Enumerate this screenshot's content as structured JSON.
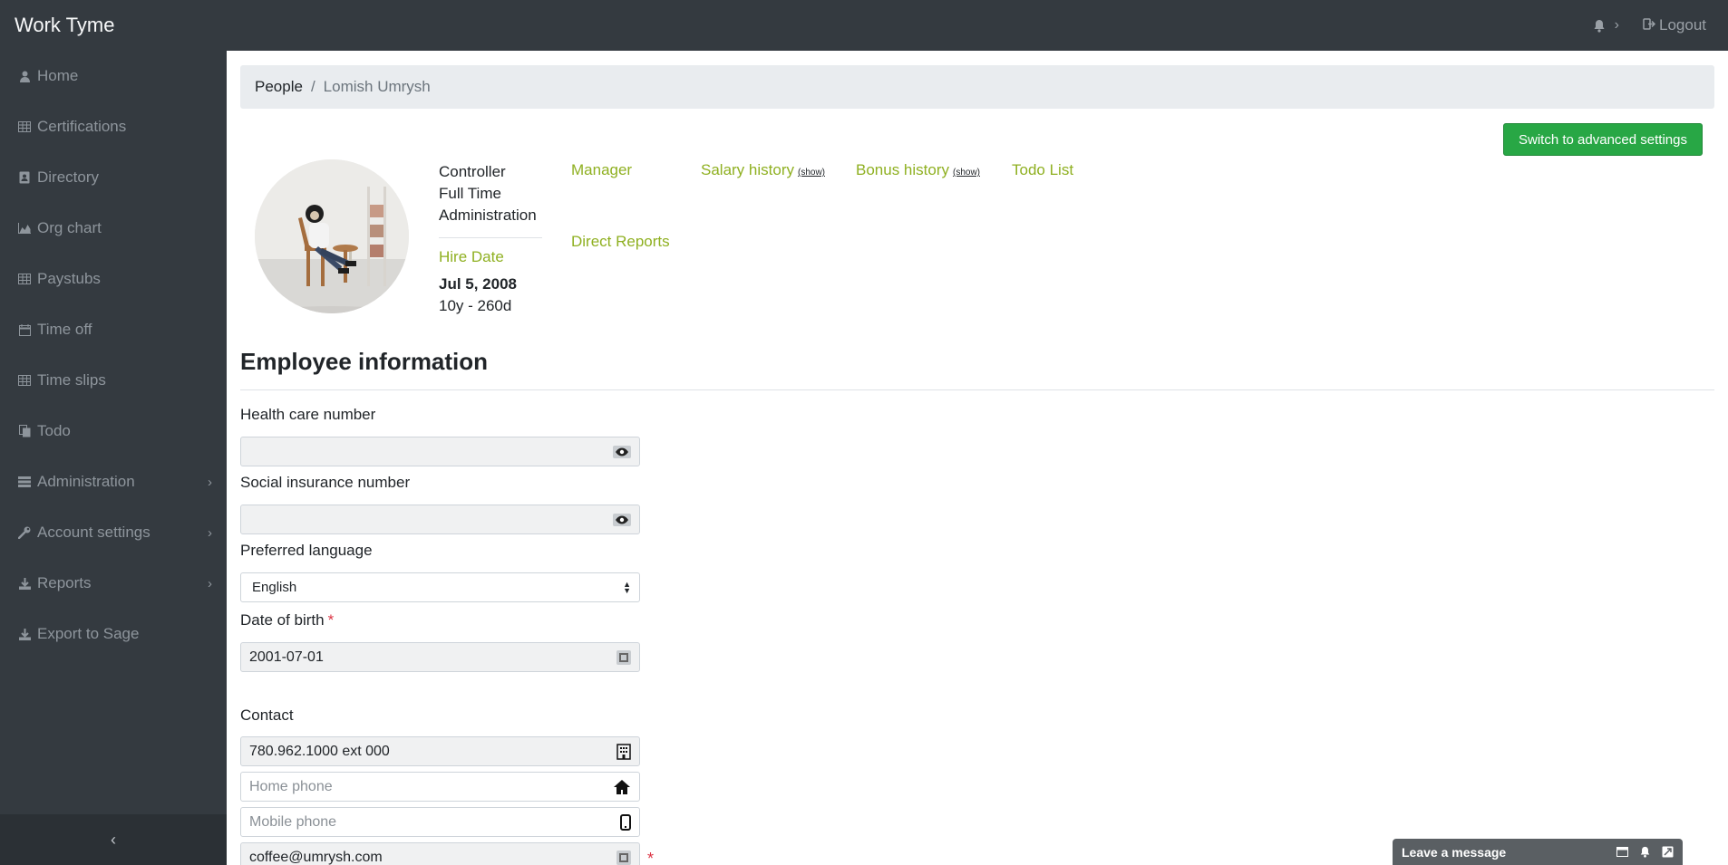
{
  "app": {
    "title": "Work Tyme"
  },
  "topbar": {
    "logout_label": "Logout"
  },
  "sidebar": {
    "items": [
      {
        "label": "Home",
        "icon": "user-icon"
      },
      {
        "label": "Certifications",
        "icon": "table-icon"
      },
      {
        "label": "Directory",
        "icon": "address-book-icon"
      },
      {
        "label": "Org chart",
        "icon": "area-chart-icon"
      },
      {
        "label": "Paystubs",
        "icon": "table-icon"
      },
      {
        "label": "Time off",
        "icon": "calendar-icon"
      },
      {
        "label": "Time slips",
        "icon": "table-icon"
      },
      {
        "label": "Todo",
        "icon": "copy-icon"
      },
      {
        "label": "Administration",
        "icon": "tasks-icon",
        "submenu": true
      },
      {
        "label": "Account settings",
        "icon": "wrench-icon",
        "submenu": true
      },
      {
        "label": "Reports",
        "icon": "download-icon",
        "submenu": true
      },
      {
        "label": "Export to Sage",
        "icon": "download-icon"
      }
    ]
  },
  "breadcrumb": {
    "parent": "People",
    "separator": "/",
    "current": "Lomish Umrysh"
  },
  "profile": {
    "advanced_button": "Switch to advanced settings",
    "role": "Controller",
    "employment_type": "Full Time",
    "department": "Administration",
    "hire_label": "Hire Date",
    "hire_date": "Jul 5, 2008",
    "tenure": "10y - 260d",
    "links": {
      "manager": "Manager",
      "direct_reports": "Direct Reports",
      "salary_history": "Salary history",
      "bonus_history": "Bonus history",
      "show": "(show)",
      "todo_list": "Todo List"
    }
  },
  "employee_info": {
    "title": "Employee information",
    "health_care_label": "Health care number",
    "health_care_value": "",
    "sin_label": "Social insurance number",
    "sin_value": "",
    "language_label": "Preferred language",
    "language_value": "English",
    "dob_label": "Date of birth",
    "dob_required": "*",
    "dob_value": "2001-07-01",
    "contact_label": "Contact",
    "work_phone_value": "780.962.1000 ext 000",
    "home_phone_placeholder": "Home phone",
    "mobile_phone_placeholder": "Mobile phone",
    "email_value": "coffee@umrysh.com",
    "email_required": "*"
  },
  "chat": {
    "label": "Leave a message"
  },
  "colors": {
    "brand_green": "#8fb021",
    "button_green": "#28a745",
    "sidebar_bg": "#343a40",
    "required_red": "#dc3545"
  }
}
